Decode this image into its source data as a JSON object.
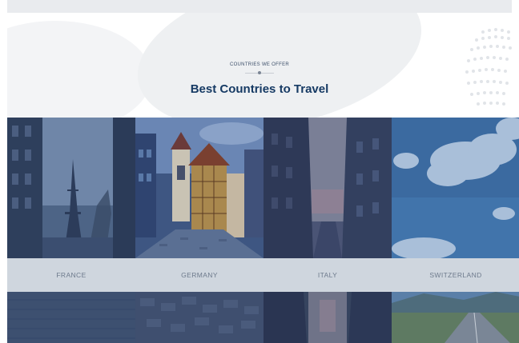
{
  "section": {
    "eyebrow": "COUNTRIES WE OFFER",
    "title": "Best Countries to Travel"
  },
  "countries": [
    {
      "name": "FRANCE",
      "scene": "paris-street-eiffel-tower"
    },
    {
      "name": "GERMANY",
      "scene": "old-town-timber-houses"
    },
    {
      "name": "ITALY",
      "scene": "city-street-at-dusk"
    },
    {
      "name": "SWITZERLAND",
      "scene": "blue-sky-clouds"
    }
  ],
  "colors": {
    "title": "#163a64",
    "band": "#cfd6de",
    "band_text": "#6d7a8c",
    "photo_tint": "#2f4a78"
  }
}
